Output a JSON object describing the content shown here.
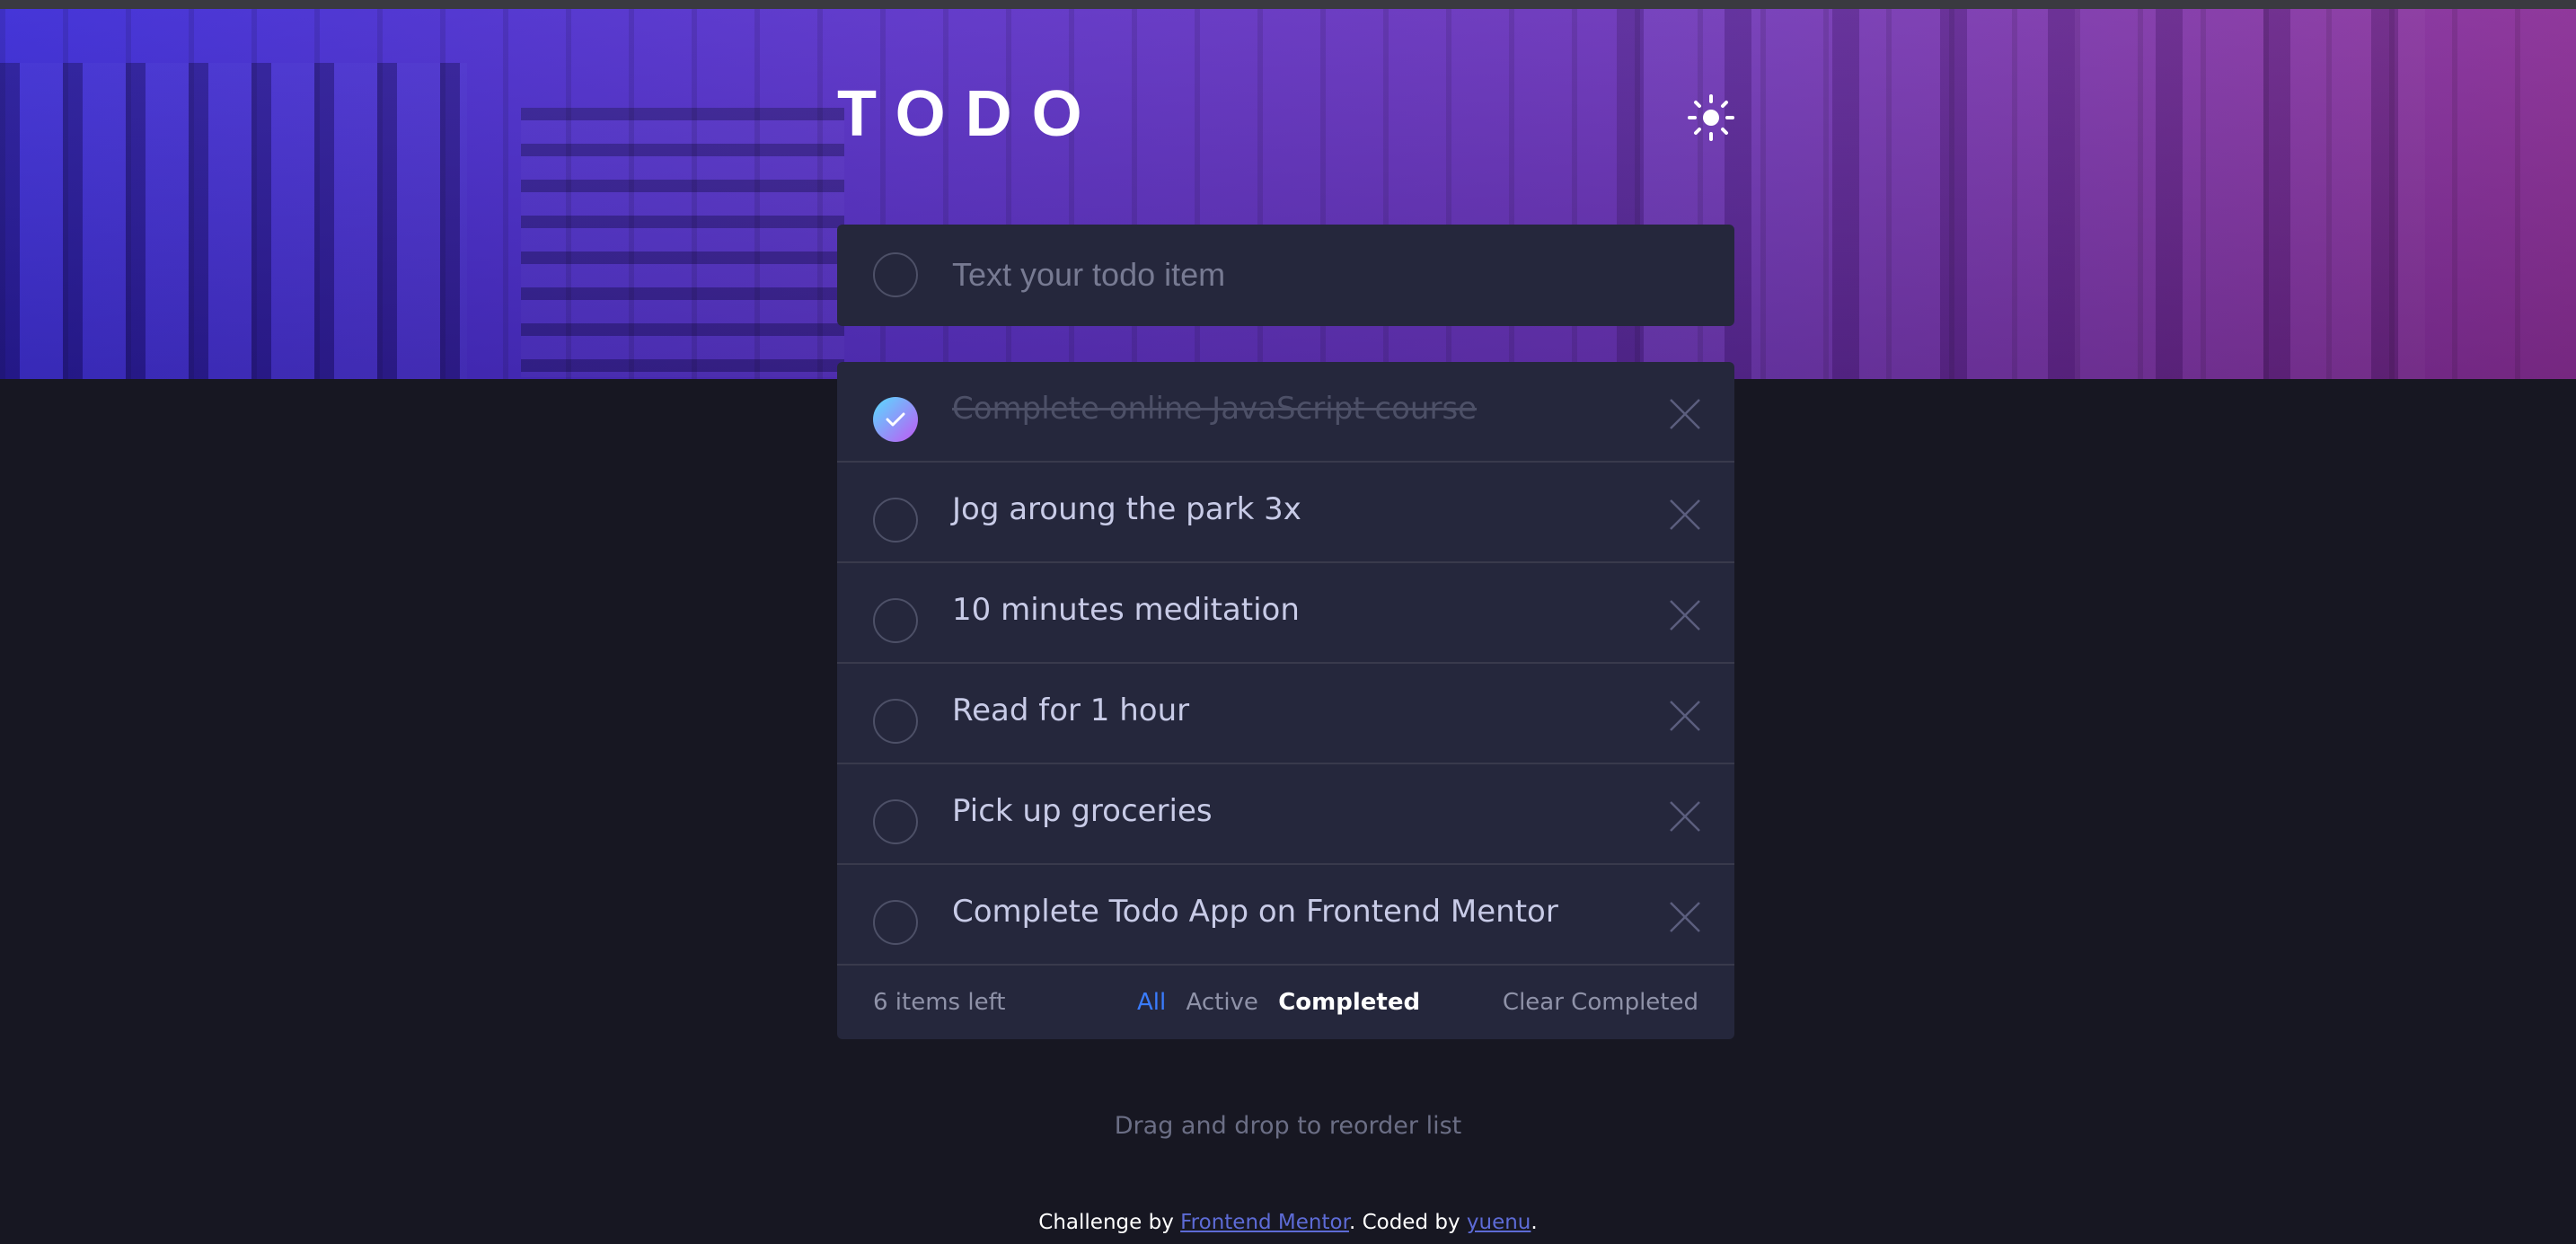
{
  "header": {
    "title": "TODO",
    "theme_icon": "sun-icon"
  },
  "new_todo": {
    "placeholder": "Text your todo item"
  },
  "todos": [
    {
      "text": "Complete online JavaScript course",
      "completed": true
    },
    {
      "text": "Jog aroung the park 3x",
      "completed": false
    },
    {
      "text": "10 minutes meditation",
      "completed": false
    },
    {
      "text": "Read for 1 hour",
      "completed": false
    },
    {
      "text": "Pick up groceries",
      "completed": false
    },
    {
      "text": "Complete Todo App on Frontend Mentor",
      "completed": false
    }
  ],
  "footer": {
    "items_left": "6 items left",
    "filters": {
      "all": "All",
      "active": "Active",
      "completed": "Completed"
    },
    "active_filter": "Completed",
    "clear_completed": "Clear Completed"
  },
  "hint": "Drag and drop to reorder list",
  "attribution": {
    "prefix": "Challenge by ",
    "challenge_link": "Frontend Mentor",
    "middle": ". Coded by ",
    "author_link": "yuenu",
    "suffix": "."
  },
  "colors": {
    "background": "#171722",
    "card": "#25273c",
    "accent": "#3a7cfd",
    "check_gradient_start": "#57ddff",
    "check_gradient_end": "#c058f3"
  }
}
